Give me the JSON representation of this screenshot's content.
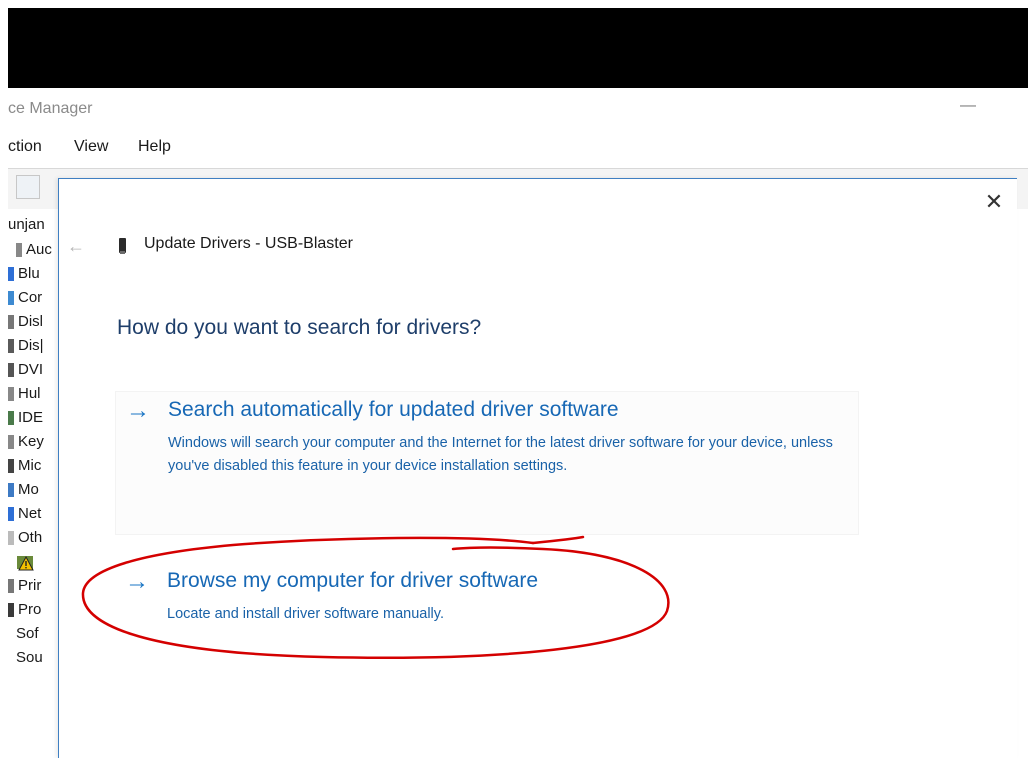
{
  "window": {
    "title": "ce Manager"
  },
  "menu": [
    "ction",
    "View",
    "Help"
  ],
  "tree": {
    "root": "unjan",
    "items": [
      "Auc",
      "Blu",
      "Cor",
      "Disl",
      "Dis|",
      "DVI",
      "Hul",
      "IDE",
      "Key",
      "Mic",
      "Mo",
      "Net",
      "Oth",
      "",
      "Prir",
      "Pro",
      "Sof",
      "Sou"
    ]
  },
  "dialog": {
    "close_label": "✕",
    "back_label": "←",
    "header": "Update Drivers - USB-Blaster",
    "question": "How do you want to search for drivers?",
    "options": [
      {
        "title": "Search automatically for updated driver software",
        "description": "Windows will search your computer and the Internet for the latest driver software for your device, unless you've disabled this feature in your device installation settings."
      },
      {
        "title": "Browse my computer for driver software",
        "description": "Locate and install driver software manually."
      }
    ]
  },
  "icons": {
    "arrow": "right-arrow-icon",
    "device": "usb-device-icon",
    "close": "close-icon",
    "back": "back-arrow-icon"
  },
  "colors": {
    "accent": "#1768b5",
    "annotation": "#d40000"
  }
}
